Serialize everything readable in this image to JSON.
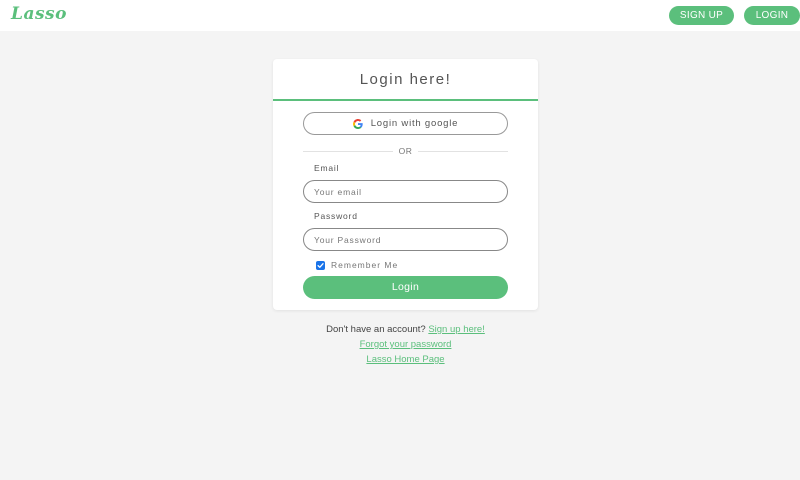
{
  "header": {
    "logo_text": "Lasso",
    "signup_label": "SIGN UP",
    "login_label": "LOGIN"
  },
  "card": {
    "title": "Login here!",
    "google_label": "Login with google",
    "or_label": "OR",
    "email_label": "Email",
    "email_placeholder": "Your email",
    "email_value": "",
    "password_label": "Password",
    "password_placeholder": "Your Password",
    "password_value": "",
    "remember_label": "Remember Me",
    "remember_checked": true,
    "submit_label": "Login"
  },
  "footer_links": {
    "no_account_text": "Don't have an account?",
    "signup_link": "Sign up here!",
    "forgot_link": "Forgot your password",
    "home_link": "Lasso Home Page"
  },
  "colors": {
    "accent": "#5bbf7c",
    "background": "#f4f4f4",
    "checkbox": "#1a73e8"
  },
  "icons": [
    "google-icon",
    "checkmark-icon"
  ]
}
